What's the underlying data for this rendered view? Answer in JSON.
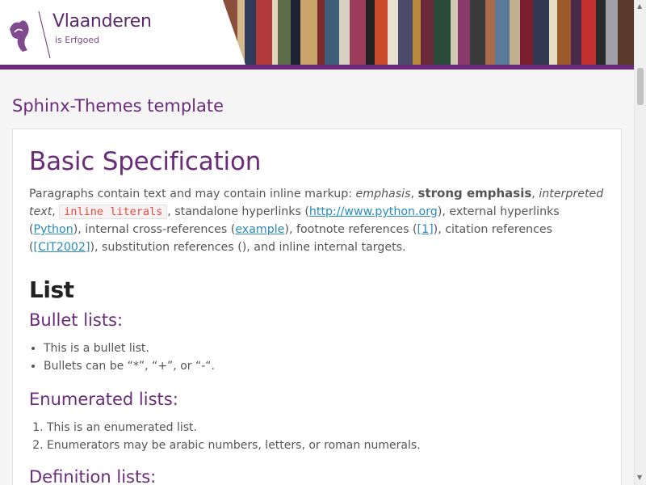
{
  "header": {
    "logo_name": "Vlaanderen",
    "logo_sub": "is Erfgoed",
    "accent": "#6a2c7a"
  },
  "page_title": "Sphinx-Themes template",
  "doc": {
    "h1": "Basic Specification",
    "para": {
      "intro": "Paragraphs contain text and may contain inline markup: ",
      "emphasis": "emphasis",
      "comma1": ", ",
      "strong": "strong emphasis",
      "comma2": ", ",
      "interpreted": "interpreted text",
      "comma3": ", ",
      "literal": "inline literals",
      "t1": ", standalone hyperlinks (",
      "link_python_org": "http://www.python.org",
      "t2": "), external hyperlinks (",
      "link_python": "Python",
      "t3": "), internal cross-references (",
      "link_example": "example",
      "t4": "), footnote references (",
      "link_footnote": "[1]",
      "t5": "), citation references (",
      "link_citation": "[CIT2002]",
      "t6": "), substitution references (), and inline internal targets."
    },
    "list_heading": "List",
    "bullet_heading": "Bullet lists:",
    "bullets": [
      "This is a bullet list.",
      "Bullets can be “*”, “+”, or “-“."
    ],
    "enum_heading": "Enumerated lists:",
    "enums": [
      "This is an enumerated list.",
      "Enumerators may be arabic numbers, letters, or roman numerals."
    ],
    "def_heading": "Definition lists:"
  },
  "icons": {
    "logo": "flemish-lion-icon",
    "scroll_up": "arrow-up-icon",
    "scroll_down": "arrow-down-icon"
  }
}
